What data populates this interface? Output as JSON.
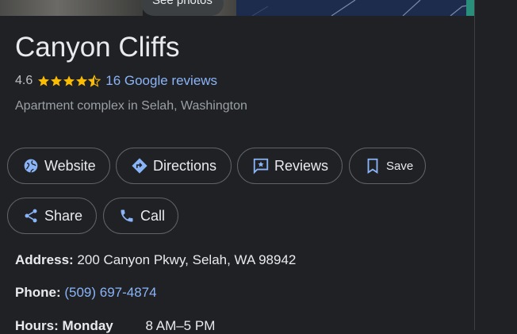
{
  "top": {
    "see_photos": "See photos"
  },
  "place": {
    "name": "Canyon Cliffs",
    "rating": "4.6",
    "stars": 4.6,
    "reviews_label": "16 Google reviews",
    "category": "Apartment complex in Selah, Washington"
  },
  "actions": {
    "website": "Website",
    "directions": "Directions",
    "reviews": "Reviews",
    "save": "Save",
    "share": "Share",
    "call": "Call"
  },
  "info": {
    "address_key": "Address:",
    "address_value": "200 Canyon Pkwy, Selah, WA 98942",
    "phone_key": "Phone:",
    "phone_value": "(509) 697-4874",
    "hours_key": "Hours:",
    "hours_day": "Monday",
    "hours_value": "8 AM–5 PM"
  },
  "colors": {
    "background": "#202124",
    "accent_link": "#8ab4f8",
    "star": "#fbbc04",
    "chip_border": "#5f6368"
  },
  "icons": [
    "globe-icon",
    "directions-icon",
    "review-icon",
    "bookmark-icon",
    "share-icon",
    "phone-icon",
    "star-icon"
  ]
}
